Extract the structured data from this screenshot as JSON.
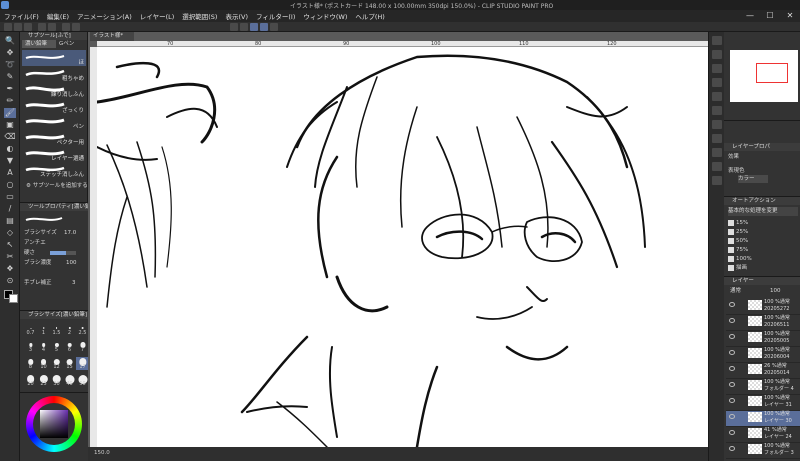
{
  "window": {
    "title": "イラスト様* (ポストカード 148.00 x 100.00mm 350dpi 150.0%) - CLIP STUDIO PAINT PRO",
    "minimize": "—",
    "maximize": "☐",
    "close": "✕"
  },
  "menu": [
    "ファイル(F)",
    "編集(E)",
    "アニメーション(A)",
    "レイヤー(L)",
    "選択範囲(S)",
    "表示(V)",
    "フィルター(I)",
    "ウィンドウ(W)",
    "ヘルプ(H)"
  ],
  "subtool": {
    "tabs": [
      "サブツール[ふで]",
      "濃い鉛筆",
      "Gペン"
    ],
    "active_tab": "濃い鉛筆",
    "brushes": [
      "ほ",
      "粗ちゃめ",
      "練り消しふん",
      "ざっくり",
      "ペン",
      "ペクター用",
      "レイヤー選通",
      "ステッチ消しふん"
    ],
    "add_label": "サブツールを追加する"
  },
  "tool_property": {
    "header": "ツールプロパティ[濃い鉛筆]",
    "brush_size_label": "ブラシサイズ",
    "brush_size_value": "17.0",
    "antialias_label": "アンチエ",
    "hardness_label": "硬さ",
    "density_label": "ブラシ濃度",
    "density_value": "100",
    "correction_label": "手ブレ補正",
    "correction_value": "3"
  },
  "brush_size_panel": {
    "header": "ブラシサイズ[濃い鉛筆]",
    "sizes": [
      "0.7",
      "1",
      "1.5",
      "2",
      "2.5",
      "3",
      "4",
      "5",
      "6",
      "7",
      "8",
      "10",
      "12",
      "15",
      "17",
      "20",
      "25",
      "30",
      "40",
      "50"
    ]
  },
  "colors": {
    "foreground": "#000000",
    "background": "#ffffff",
    "accent": "#5a6e9a",
    "dark_panel": "#333333",
    "canvas": "#ffffff"
  },
  "canvas": {
    "tab_label": "イラスト様*",
    "ruler_marks": [
      "70",
      "80",
      "90",
      "100",
      "110",
      "120"
    ],
    "zoom": "150.0",
    "status": "150.0"
  },
  "layer_property": {
    "header": "レイヤープロパ",
    "effect_label": "効果",
    "color_label": "表現色",
    "color_value": "カラー"
  },
  "auto_action": {
    "header": "オートアクション",
    "set_name": "基本的な処理を変更",
    "items": [
      "15%",
      "25%",
      "50%",
      "75%",
      "100%",
      "描画"
    ]
  },
  "layers": {
    "header": "レイヤー",
    "blend_mode": "通常",
    "opacity": "100",
    "items": [
      {
        "pct": "100 %通常",
        "name": "20205272"
      },
      {
        "pct": "100 %通常",
        "name": "20206511"
      },
      {
        "pct": "100 %通常",
        "name": "20205005"
      },
      {
        "pct": "100 %通常",
        "name": "20206004"
      },
      {
        "pct": "26 %通常",
        "name": "20205014"
      },
      {
        "pct": "100 %通常",
        "name": "フォルダー 4"
      },
      {
        "pct": "100 %通常",
        "name": "レイヤー 31"
      },
      {
        "pct": "100 %通常",
        "name": "レイヤー 30"
      },
      {
        "pct": "41 %通常",
        "name": "レイヤー 24"
      },
      {
        "pct": "100 %通常",
        "name": "フォルダー 3"
      }
    ],
    "selected_index": 7
  }
}
